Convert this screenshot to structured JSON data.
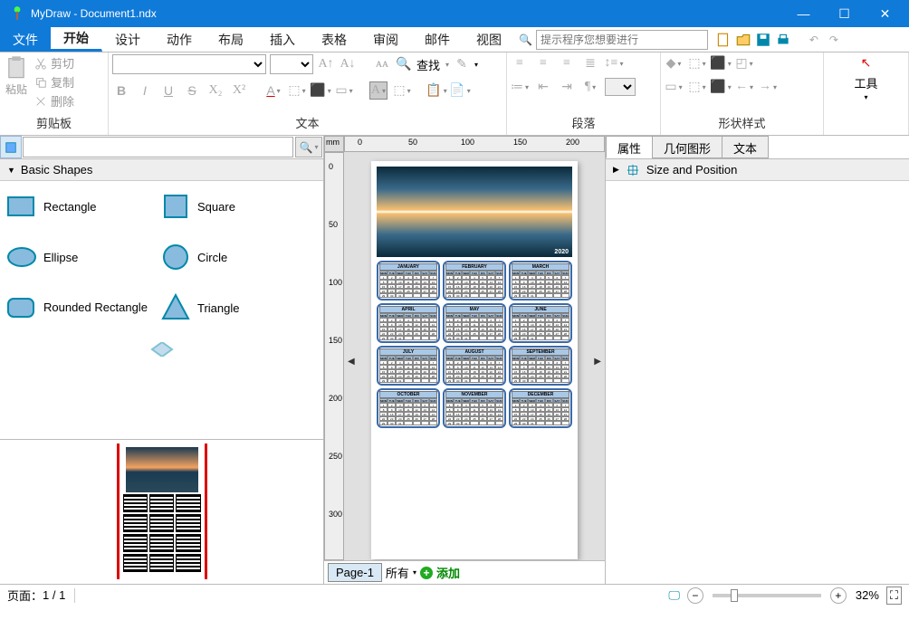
{
  "title": "MyDraw - Document1.ndx",
  "window_controls": {
    "minimize": "—",
    "maximize": "☐",
    "close": "✕"
  },
  "ribbon": {
    "file": "文件",
    "tabs": [
      "开始",
      "设计",
      "动作",
      "布局",
      "插入",
      "表格",
      "审阅",
      "邮件",
      "视图"
    ],
    "active_tab": "开始",
    "search_placeholder": "提示程序您想要进行",
    "groups": {
      "clipboard": {
        "label": "剪贴板",
        "paste": "粘贴",
        "cut": "剪切",
        "copy": "复制",
        "delete": "删除"
      },
      "text": {
        "label": "文本",
        "find": "查找"
      },
      "paragraph": {
        "label": "段落"
      },
      "shape_style": {
        "label": "形状样式"
      },
      "tools": {
        "label": "工具"
      }
    }
  },
  "left": {
    "shapes_header": "Basic Shapes",
    "shapes": [
      {
        "a": "Rectangle",
        "b": "Square"
      },
      {
        "a": "Ellipse",
        "b": "Circle"
      },
      {
        "a": "Rounded Rectangle",
        "b": "Triangle"
      }
    ]
  },
  "canvas": {
    "ruler_unit": "mm",
    "h_ticks": [
      "0",
      "50",
      "100",
      "150",
      "200"
    ],
    "v_ticks": [
      "0",
      "50",
      "100",
      "150",
      "200",
      "250",
      "300"
    ],
    "page_tab": "Page-1",
    "all": "所有",
    "add": "添加",
    "hero_year": "2020",
    "months": [
      "JANUARY",
      "FEBRUARY",
      "MARCH",
      "APRIL",
      "MAY",
      "JUNE",
      "JULY",
      "AUGUST",
      "SEPTEMBER",
      "OCTOBER",
      "NOVEMBER",
      "DECEMBER"
    ],
    "dow": [
      "MON",
      "TUE",
      "WED",
      "THU",
      "FRI",
      "SAT",
      "SUN"
    ]
  },
  "right": {
    "tabs": [
      "属性",
      "几何图形",
      "文本"
    ],
    "section": "Size and Position"
  },
  "status": {
    "page_label": "页面：",
    "page_value": "1 / 1",
    "zoom": "32%"
  }
}
